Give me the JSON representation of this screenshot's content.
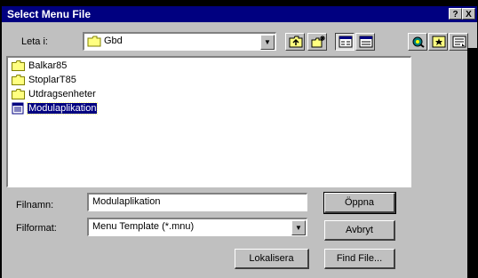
{
  "background_text": "0 0 0 0 1 0 0 0 0 0 1 0 0 1 0 1 1 0 0 0 1 1 0 0 1 1 1 0 0",
  "dialog": {
    "title": "Select Menu File",
    "help_button": "?",
    "close_button": "X"
  },
  "look_in": {
    "label": "Leta i:",
    "value": "Gbd"
  },
  "toolbar": {
    "icons": [
      "up-one-level-icon",
      "create-new-folder-icon",
      "list-view-icon",
      "details-view-icon",
      "find-icon",
      "bookmark-icon",
      "preview-icon"
    ]
  },
  "files": [
    {
      "name": "Balkar85",
      "type": "folder",
      "selected": false
    },
    {
      "name": "StoplarT85",
      "type": "folder",
      "selected": false
    },
    {
      "name": "Utdragsenheter",
      "type": "folder",
      "selected": false
    },
    {
      "name": "Modulaplikation",
      "type": "menu-file",
      "selected": true
    }
  ],
  "filename": {
    "label": "Filnamn:",
    "value": "Modulaplikation"
  },
  "fileformat": {
    "label": "Filformat:",
    "value": "Menu Template (*.mnu)"
  },
  "buttons": {
    "open": "Öppna",
    "cancel": "Avbryt",
    "locate": "Lokalisera",
    "find_file": "Find File..."
  },
  "colors": {
    "titlebar": "#000080",
    "dialog_face": "#c0c0c0",
    "selection": "#000080"
  }
}
